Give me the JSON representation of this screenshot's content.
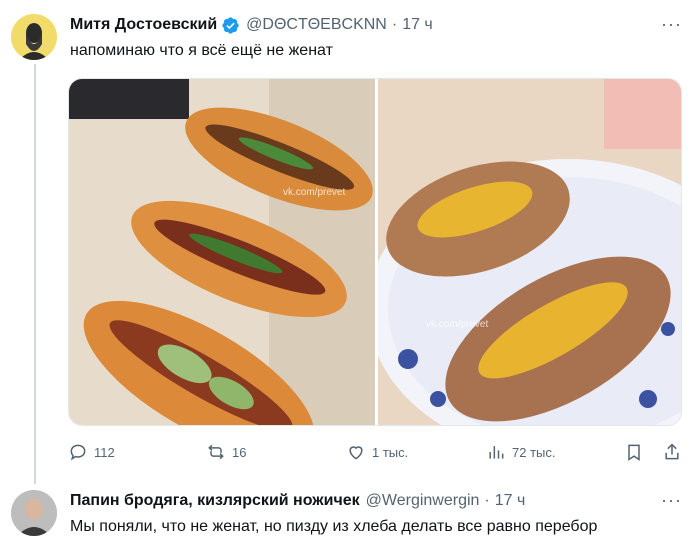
{
  "tweet": {
    "author_name": "Митя Достоевский",
    "handle": "@DΘCTΘEBCKNN",
    "separator": "·",
    "time": "17 ч",
    "more": "···",
    "text": "напоминаю что я всё ещё не женат",
    "watermark_left": "vk.com/prevet",
    "watermark_right": "vk.com/prevet",
    "actions": {
      "replies": "112",
      "retweets": "16",
      "likes": "1 тыс.",
      "views": "72 тыс."
    }
  },
  "reply": {
    "author_name": "Папин бродяга, кизлярский ножичек",
    "handle": "@Werginwergin",
    "separator": "·",
    "time": "17 ч",
    "more": "···",
    "text": "Мы поняли, что не женат, но пизду из хлеба делать все равно перебор"
  },
  "colors": {
    "text_primary": "#0f1419",
    "text_secondary": "#536471",
    "verified_blue": "#1d9bf0",
    "thread_line": "#cfd9de"
  },
  "icons": [
    "avatar",
    "verified-badge-icon",
    "more-icon",
    "reply-icon",
    "retweet-icon",
    "like-icon",
    "views-icon",
    "bookmark-icon",
    "share-icon"
  ]
}
